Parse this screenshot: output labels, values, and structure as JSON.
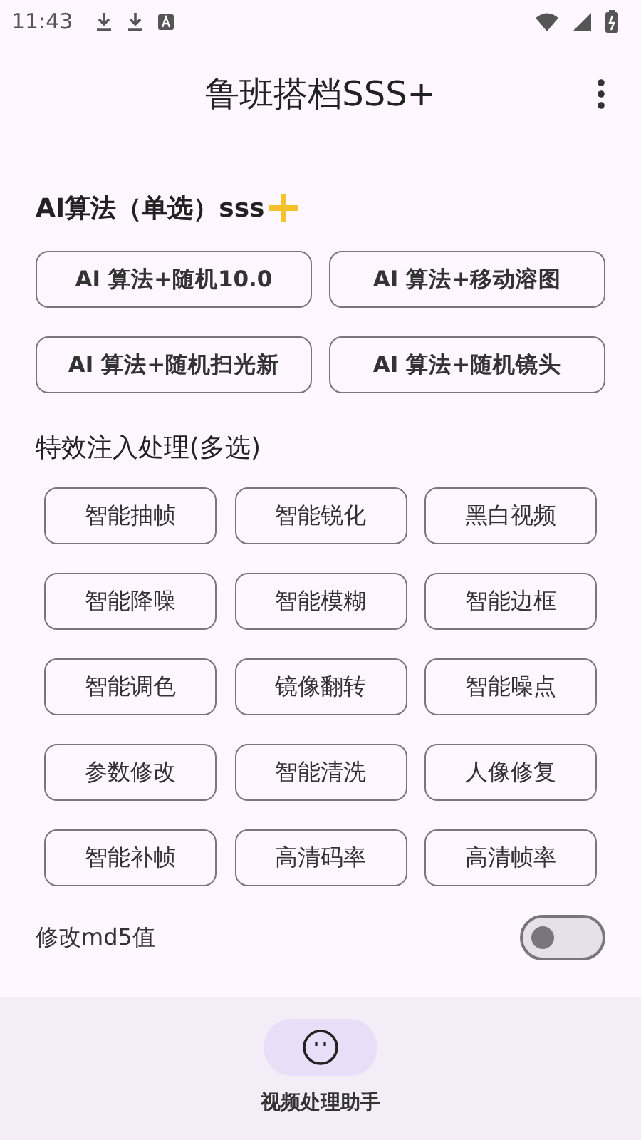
{
  "status_bar": {
    "time": "11:43"
  },
  "app_bar": {
    "title": "鲁班搭档SSS+"
  },
  "single_section": {
    "title": "AI算法（单选）sss",
    "options": [
      {
        "label": "AI 算法+随机10.0",
        "selected": false
      },
      {
        "label": "AI 算法+移动溶图",
        "selected": false
      },
      {
        "label": "AI 算法+随机扫光新",
        "selected": false
      },
      {
        "label": "AI 算法+随机镜头",
        "selected": false
      }
    ]
  },
  "multi_section": {
    "title": "特效注入处理(多选)",
    "options": [
      {
        "label": "智能抽帧",
        "selected": false
      },
      {
        "label": "智能锐化",
        "selected": false
      },
      {
        "label": "黑白视频",
        "selected": false
      },
      {
        "label": "智能降噪",
        "selected": false
      },
      {
        "label": "智能模糊",
        "selected": false
      },
      {
        "label": "智能边框",
        "selected": false
      },
      {
        "label": "智能调色",
        "selected": false
      },
      {
        "label": "镜像翻转",
        "selected": false
      },
      {
        "label": "智能噪点",
        "selected": false
      },
      {
        "label": "参数修改",
        "selected": false
      },
      {
        "label": "智能清洗",
        "selected": false
      },
      {
        "label": "人像修复",
        "selected": false
      },
      {
        "label": "智能补帧",
        "selected": false
      },
      {
        "label": "高清码率",
        "selected": false
      },
      {
        "label": "高清帧率",
        "selected": false
      }
    ]
  },
  "md5_switch": {
    "label": "修改md5值",
    "on": false
  },
  "bottom_nav": {
    "items": [
      {
        "label": "视频处理助手",
        "selected": true
      }
    ]
  }
}
